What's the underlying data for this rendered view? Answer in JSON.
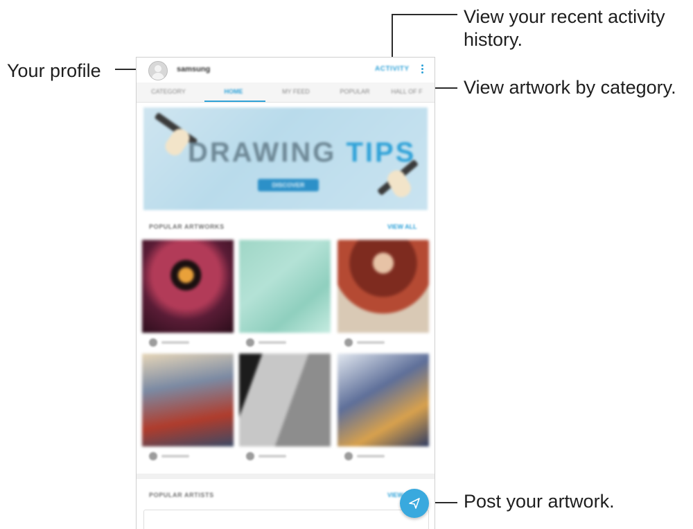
{
  "callouts": {
    "profile": "Your profile",
    "activity_line1": "View your recent activity",
    "activity_line2": "history.",
    "category": "View artwork by category.",
    "post": "Post your artwork."
  },
  "appbar": {
    "username": "samsung",
    "activity_label": "ACTIVITY",
    "more_icon": "vertical-dots-icon"
  },
  "tabs": [
    {
      "label": "CATEGORY"
    },
    {
      "label": "HOME",
      "active": true
    },
    {
      "label": "MY FEED"
    },
    {
      "label": "POPULAR"
    },
    {
      "label": "HALL OF F"
    }
  ],
  "banner": {
    "title_part1": "DRAWING ",
    "title_part2": "TIPS",
    "button_label": "DISCOVER"
  },
  "sections": {
    "popular_artworks": "POPULAR ARTWORKS",
    "popular_artworks_link": "VIEW ALL",
    "popular_artists": "POPULAR ARTISTS",
    "popular_artists_link": "VIEW"
  },
  "fab": {
    "icon": "send-icon",
    "color": "#39a9de"
  },
  "colors": {
    "accent": "#2fa2d8"
  }
}
